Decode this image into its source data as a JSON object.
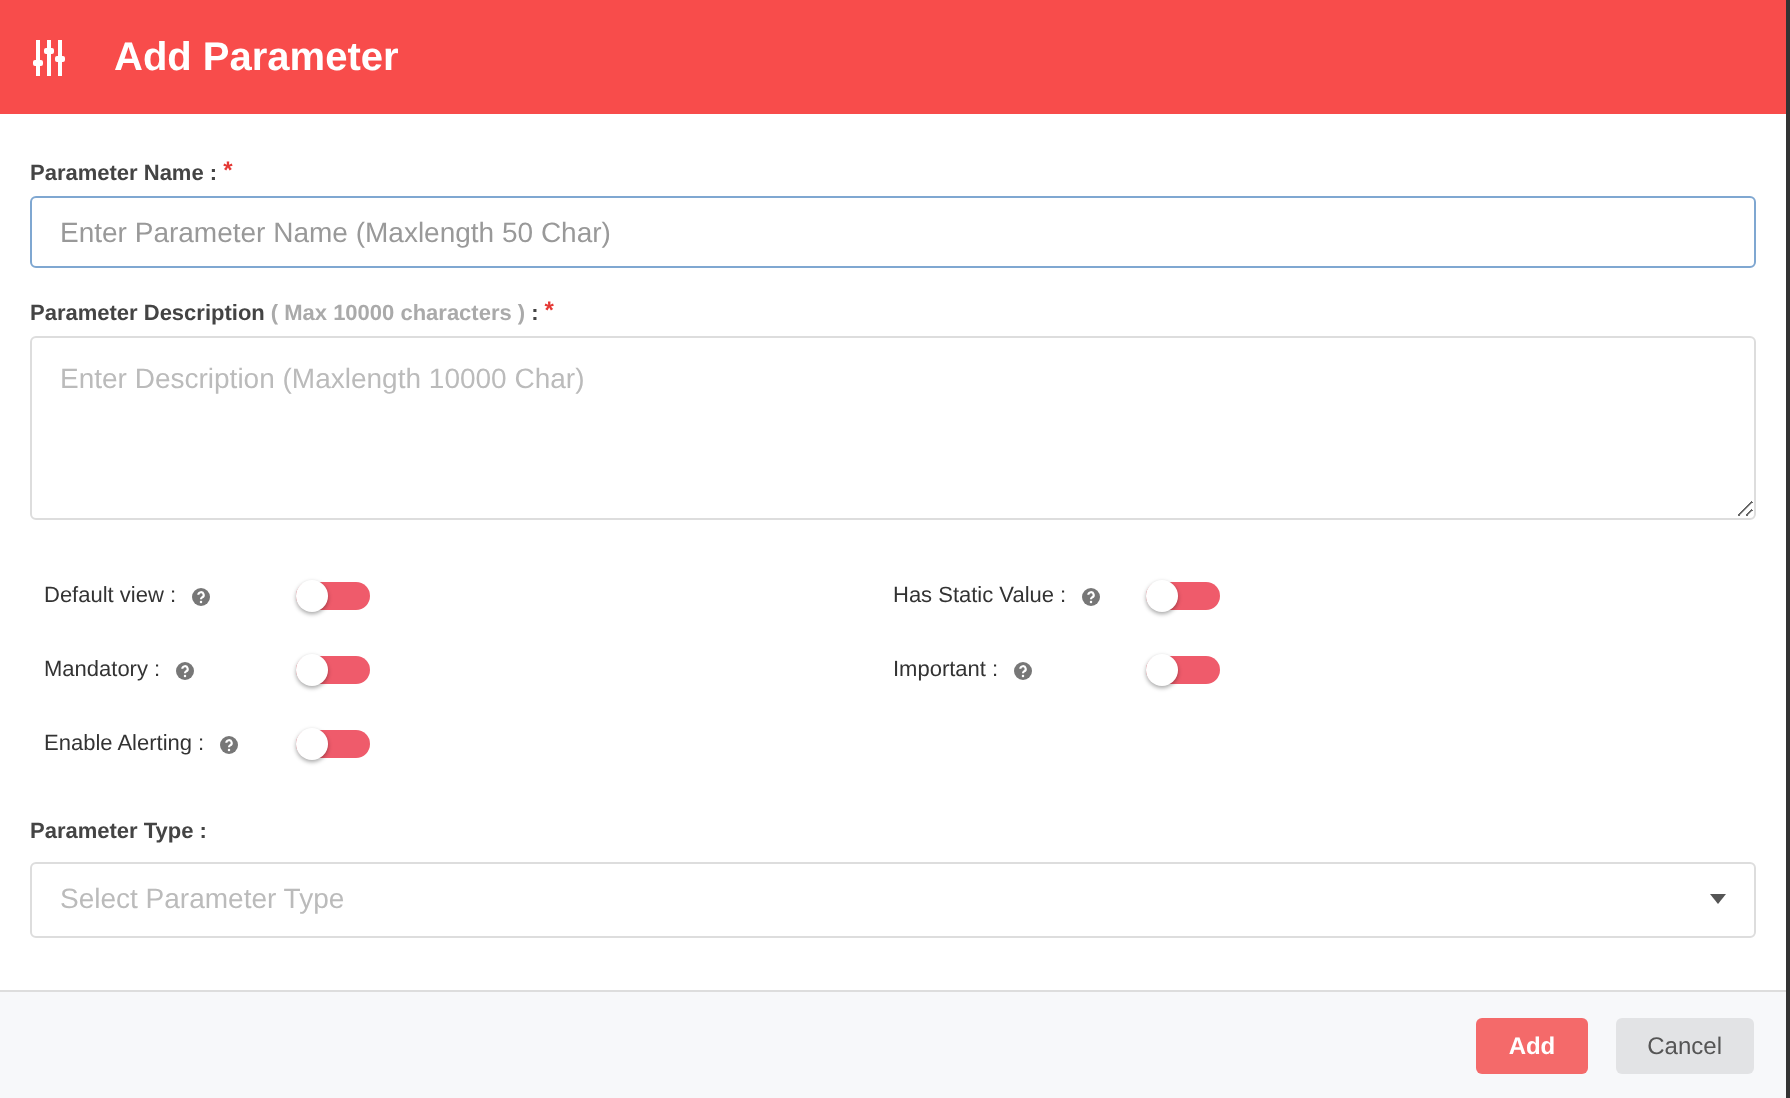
{
  "header": {
    "title": "Add Parameter"
  },
  "name_field": {
    "label": "Parameter Name :",
    "required_mark": "*",
    "placeholder": "Enter Parameter Name (Maxlength 50 Char)",
    "focused": true
  },
  "description_field": {
    "label": "Parameter Description",
    "hint": "( Max 10000 characters )",
    "label_suffix": ":",
    "required_mark": "*",
    "placeholder": "Enter Description (Maxlength 10000 Char)"
  },
  "toggles": [
    {
      "label": "Default view :",
      "on": false
    },
    {
      "label": "Has Static Value :",
      "on": false
    },
    {
      "label": "Mandatory :",
      "on": false
    },
    {
      "label": "Important :",
      "on": false
    },
    {
      "label": "Enable Alerting :",
      "on": false
    }
  ],
  "type_field": {
    "label": "Parameter Type :",
    "placeholder": "Select Parameter Type"
  },
  "buttons": [
    {
      "label": "Add",
      "kind": "primary"
    },
    {
      "label": "Cancel",
      "kind": "secondary"
    }
  ]
}
